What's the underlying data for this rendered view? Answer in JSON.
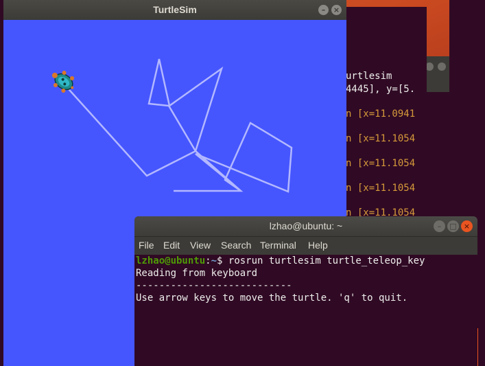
{
  "bg_terminal": {
    "lines": [
      {
        "text": "urtlesim",
        "color": "white"
      },
      {
        "text": "4445], y=[5.",
        "color": "white"
      },
      {
        "text": "n [x=11.0941",
        "color": "orange"
      },
      {
        "text": "n [x=11.1054",
        "color": "orange"
      },
      {
        "text": "n [x=11.1054",
        "color": "orange"
      },
      {
        "text": "n [x=11.1054",
        "color": "orange"
      },
      {
        "text": "n [x=11.1054",
        "color": "orange"
      }
    ]
  },
  "turtlesim": {
    "title": "TurtleSim",
    "background_color": "#4556ff",
    "path_color": "#b3b8ff",
    "turtle_icon": "turtle-icon",
    "minimize_icon": "minimize-icon",
    "close_icon": "close-icon"
  },
  "terminal": {
    "title": "lzhao@ubuntu: ~",
    "menu": [
      "File",
      "Edit",
      "View",
      "Search",
      "Terminal",
      "Help"
    ],
    "prompt_user": "lzhao@ubuntu",
    "prompt_sep": ":",
    "prompt_path": "~",
    "prompt_symbol": "$ ",
    "command": "rosrun turtlesim turtle_teleop_key",
    "output": [
      "Reading from keyboard",
      "---------------------------",
      "Use arrow keys to move the turtle. 'q' to quit."
    ],
    "buttons": [
      "minimize-icon",
      "maximize-icon",
      "close-icon"
    ]
  }
}
